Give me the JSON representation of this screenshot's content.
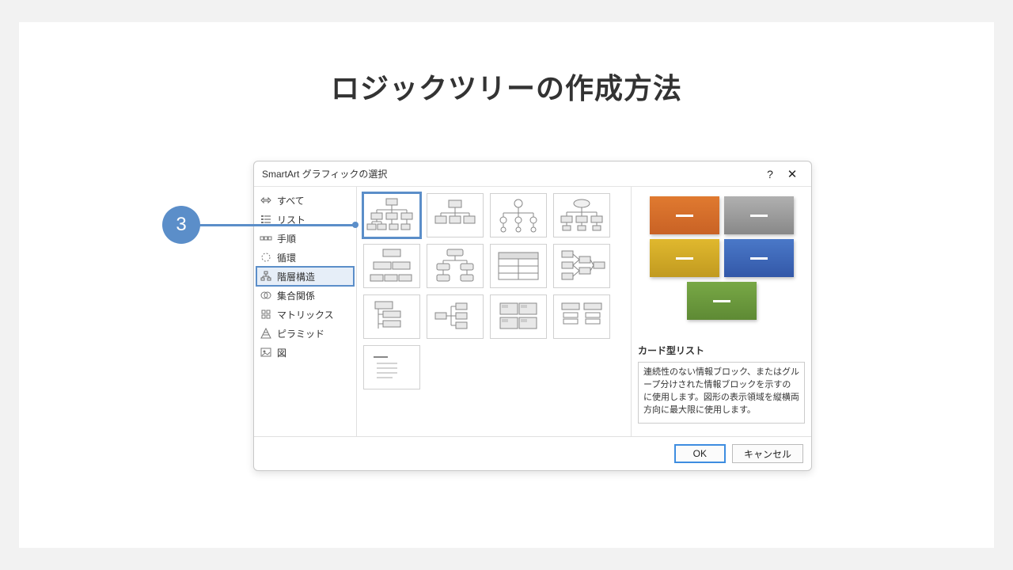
{
  "slide_title": "ロジックツリーの作成方法",
  "annotation": {
    "number": "3"
  },
  "dialog": {
    "title": "SmartArt グラフィックの選択",
    "help_tip": "?",
    "categories": [
      {
        "label": "すべて"
      },
      {
        "label": "リスト"
      },
      {
        "label": "手順"
      },
      {
        "label": "循環"
      },
      {
        "label": "階層構造"
      },
      {
        "label": "集合関係"
      },
      {
        "label": "マトリックス"
      },
      {
        "label": "ピラミッド"
      },
      {
        "label": "図"
      }
    ],
    "selected_category_index": 4,
    "selected_layout_index": 0,
    "preview": {
      "heading": "カード型リスト",
      "description": "連続性のない情報ブロック、またはグループ分けされた情報ブロックを示すのに使用します。図形の表示領域を縦横両方向に最大限に使用します。",
      "card_colors": [
        "#d96f2a",
        "#9b9b9b",
        "#d0a927",
        "#3e68b4",
        "#6a9a3a"
      ]
    },
    "buttons": {
      "ok": "OK",
      "cancel": "キャンセル"
    }
  }
}
